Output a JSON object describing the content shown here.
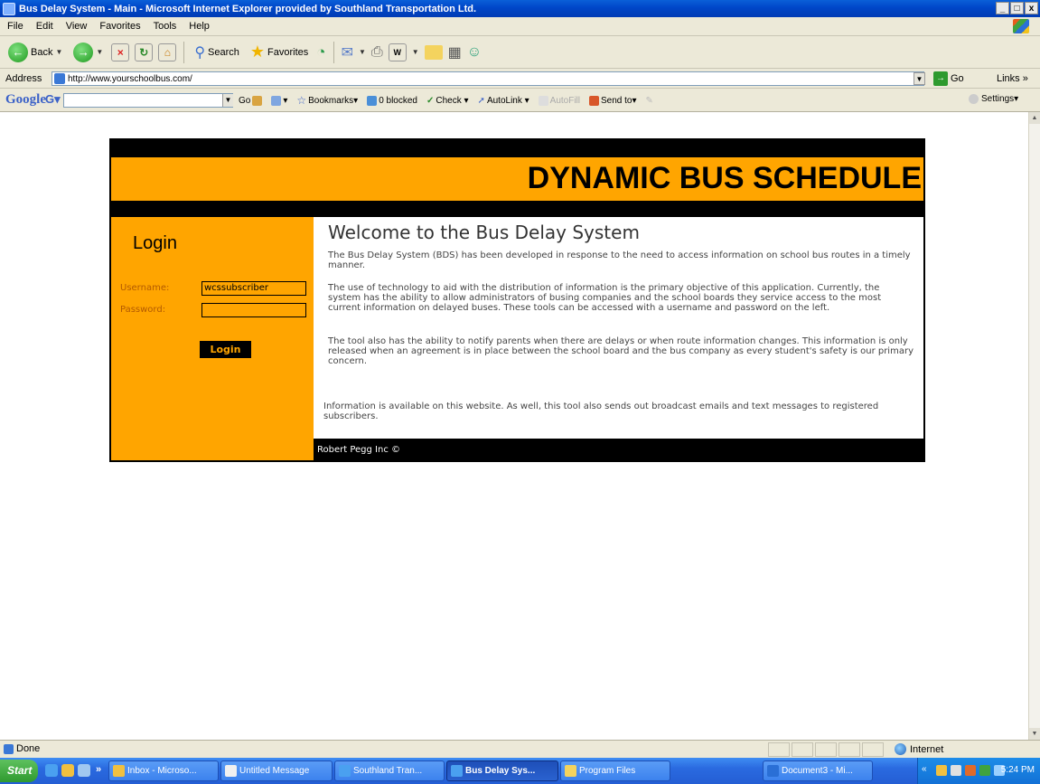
{
  "window": {
    "title": "Bus Delay System - Main - Microsoft Internet Explorer provided by Southland Transportation Ltd.",
    "controls": [
      "_",
      "□",
      "x"
    ]
  },
  "menu": [
    "File",
    "Edit",
    "View",
    "Favorites",
    "Tools",
    "Help"
  ],
  "toolbar": {
    "back": "Back",
    "search": "Search",
    "favorites": "Favorites"
  },
  "address": {
    "label": "Address",
    "url": "http://www.yourschoolbus.com/",
    "go": "Go",
    "links": "Links »"
  },
  "google": {
    "logo": "Google",
    "g_button": "G",
    "go": "Go",
    "bookmarks": "Bookmarks▾",
    "blocked": "0 blocked",
    "check": "Check ▾",
    "autolink": "AutoLink ▾",
    "autofill": "AutoFill",
    "sendto": "Send to▾",
    "settings": "Settings▾"
  },
  "site": {
    "banner": "DYNAMIC BUS SCHEDULE",
    "login_heading": "Login",
    "username_label": "Username:",
    "username_value": "wcssubscriber",
    "password_label": "Password:",
    "password_value": "",
    "login_button": "Login",
    "welcome_heading": "Welcome to the Bus Delay System",
    "paragraphs": [
      "The Bus Delay System (BDS) has been developed in response to the need to access information on school bus routes in a timely manner.",
      "The use of technology to aid with the distribution of information is the primary objective of this application. Currently, the system has the ability to allow administrators of busing companies and the school boards they service access to the most current information on delayed buses. These tools can be accessed with a username and password on the left.",
      "The tool also has the ability to notify parents when there are delays or when route information changes. This information is only released when an agreement is in place between the school board and the bus company as every student's safety is our primary concern.",
      "Information is available on this website. As well, this tool also sends out broadcast emails and text messages to registered subscribers."
    ],
    "footer": "Robert Pegg Inc ©"
  },
  "status": {
    "text": "Done",
    "zone": "Internet"
  },
  "taskbar": {
    "start": "Start",
    "overflow": "»",
    "buttons": [
      "Inbox - Microso...",
      "Untitled Message",
      "Southland Tran...",
      "Bus Delay Sys...",
      "Program Files",
      "Document3 - Mi..."
    ],
    "clock": "5:24 PM"
  }
}
